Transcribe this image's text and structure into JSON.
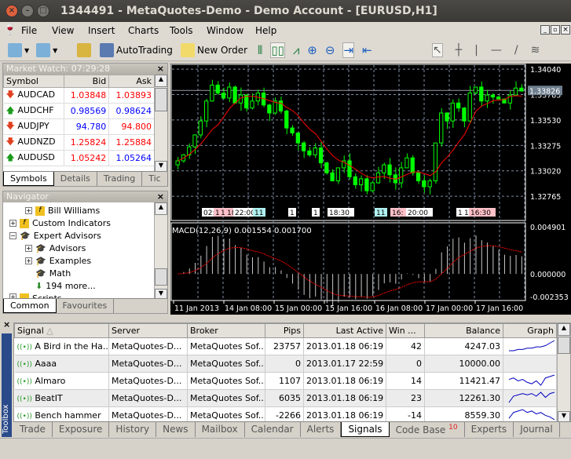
{
  "window": {
    "title": "1344491 - MetaQuotes-Demo - Demo Account - [EURUSD,H1]"
  },
  "menu": [
    "File",
    "View",
    "Insert",
    "Charts",
    "Tools",
    "Window",
    "Help"
  ],
  "toolbar": {
    "autotrading": "AutoTrading",
    "new_order": "New Order"
  },
  "market_watch": {
    "title": "Market Watch: 07:29:28",
    "headers": [
      "Symbol",
      "Bid",
      "Ask"
    ],
    "rows": [
      {
        "symbol": "AUDCAD",
        "dir": "down",
        "bid": "1.03848",
        "ask": "1.03893",
        "bid_color": "#ff0000",
        "ask_color": "#ff0000"
      },
      {
        "symbol": "AUDCHF",
        "dir": "up",
        "bid": "0.98569",
        "ask": "0.98624",
        "bid_color": "#0000ff",
        "ask_color": "#0000ff"
      },
      {
        "symbol": "AUDJPY",
        "dir": "down",
        "bid": "94.780",
        "ask": "94.800",
        "bid_color": "#0000ff",
        "ask_color": "#ff0000"
      },
      {
        "symbol": "AUDNZD",
        "dir": "down",
        "bid": "1.25824",
        "ask": "1.25884",
        "bid_color": "#ff0000",
        "ask_color": "#ff0000"
      },
      {
        "symbol": "AUDUSD",
        "dir": "up",
        "bid": "1.05242",
        "ask": "1.05264",
        "bid_color": "#ff0000",
        "ask_color": "#0000ff"
      }
    ],
    "tabs": [
      "Symbols",
      "Details",
      "Trading",
      "Tic"
    ]
  },
  "navigator": {
    "title": "Navigator",
    "items": [
      "Bill Williams",
      "Custom Indicators",
      "Expert Advisors",
      "Advisors",
      "Examples",
      "Math",
      "194 more...",
      "Scripts"
    ],
    "tabs": [
      "Common",
      "Favourites"
    ]
  },
  "chart": {
    "symbol": "EURUSD",
    "timeframe": "H1",
    "current_price": "1.33826",
    "price_labels": [
      "1.34040",
      "1.33785",
      "1.33530",
      "1.33275",
      "1.33020",
      "1.32765"
    ],
    "closes": [
      1.3312,
      1.3318,
      1.3326,
      1.3338,
      1.3352,
      1.3372,
      1.3388,
      1.338,
      1.3375,
      1.3386,
      1.337,
      1.3378,
      1.3365,
      1.3372,
      1.338,
      1.3368,
      1.336,
      1.3372,
      1.3362,
      1.3345,
      1.334,
      1.333,
      1.3322,
      1.3318,
      1.3325,
      1.331,
      1.33,
      1.3292,
      1.3305,
      1.3312,
      1.3296,
      1.3288,
      1.3294,
      1.3282,
      1.329,
      1.33,
      1.3308,
      1.3298,
      1.329,
      1.3305,
      1.3315,
      1.33,
      1.3292,
      1.3286,
      1.3292,
      1.333,
      1.336,
      1.3352,
      1.337,
      1.3365,
      1.3352,
      1.338,
      1.3386,
      1.3372,
      1.3378,
      1.3376,
      1.3374,
      1.337,
      1.3378,
      1.3385,
      1.3382
    ],
    "event_labels": [
      "02:20",
      "11:",
      "1",
      "18:",
      "22:00",
      "11",
      "1",
      "1",
      "18:30",
      "11",
      "16:",
      "20:00",
      "1",
      "1",
      "16:30"
    ],
    "macd": {
      "label": "MACD(12,26,9) 0.001554 0.001700",
      "max": "0.004901",
      "zero": "0.000000",
      "min": "-0.002353"
    },
    "time_labels": [
      "11 Jan 2013",
      "14 Jan 08:00",
      "15 Jan 00:00",
      "15 Jan 16:00",
      "16 Jan 08:00",
      "17 Jan 00:00",
      "17 Jan 16:00"
    ],
    "colors": {
      "bull": "#00ff00",
      "ma": "#ff0000",
      "grid": "#7f8fa6"
    }
  },
  "toolbox": {
    "label": "Toolbox",
    "headers": [
      "Signal",
      "Server",
      "Broker",
      "Pips",
      "Last Active",
      "Win ...",
      "Balance",
      "Graph"
    ],
    "rows": [
      {
        "signal": "A Bird in the Ha...",
        "server": "MetaQuotes-D...",
        "broker": "MetaQuotes Sof...",
        "pips": "23757",
        "last": "2013.01.18 06:19",
        "win": "42",
        "balance": "4247.03",
        "graph": [
          0,
          0,
          1,
          1,
          2,
          2,
          3,
          3,
          4,
          6,
          8
        ]
      },
      {
        "signal": "Aaaa",
        "server": "MetaQuotes-D...",
        "broker": "MetaQuotes Sof...",
        "pips": "0",
        "last": "2013.01.17 22:59",
        "win": "0",
        "balance": "10000.00",
        "graph": []
      },
      {
        "signal": "Almaro",
        "server": "MetaQuotes-D...",
        "broker": "MetaQuotes Sof...",
        "pips": "1107",
        "last": "2013.01.18 06:19",
        "win": "14",
        "balance": "11421.47",
        "graph": [
          5,
          6,
          4,
          5,
          3,
          2,
          4,
          1,
          6,
          7,
          8
        ]
      },
      {
        "signal": "BeatIT",
        "server": "MetaQuotes-D...",
        "broker": "MetaQuotes Sof...",
        "pips": "6035",
        "last": "2013.01.18 06:19",
        "win": "23",
        "balance": "12261.30",
        "graph": [
          0,
          5,
          6,
          7,
          6,
          7,
          5,
          8,
          4,
          7,
          8
        ]
      },
      {
        "signal": "Bench hammer",
        "server": "MetaQuotes-D...",
        "broker": "MetaQuotes Sof...",
        "pips": "-2266",
        "last": "2013.01.18 06:19",
        "win": "-14",
        "balance": "8559.30",
        "graph": [
          2,
          6,
          7,
          8,
          6,
          7,
          5,
          6,
          4,
          3,
          1
        ]
      }
    ],
    "tabs": [
      "Trade",
      "Exposure",
      "History",
      "News",
      "Mailbox",
      "Calendar",
      "Alerts",
      "Signals",
      "Code Base",
      "Experts",
      "Journal"
    ],
    "codebase_badge": "10",
    "active_tab": "Signals"
  }
}
